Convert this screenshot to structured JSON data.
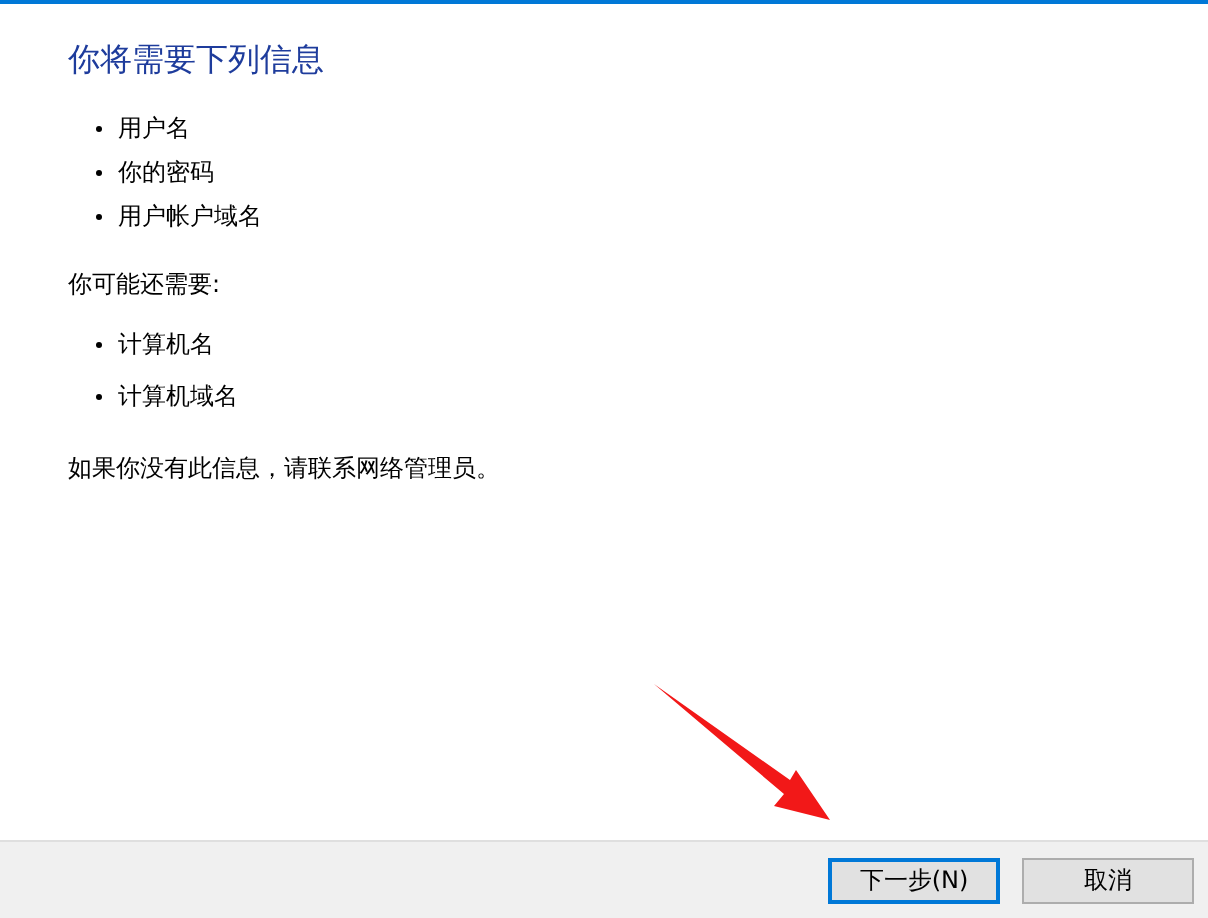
{
  "heading": "你将需要下列信息",
  "required_items": [
    "用户名",
    "你的密码",
    "用户帐户域名"
  ],
  "optional_label": "你可能还需要:",
  "optional_items": [
    "计算机名",
    "计算机域名"
  ],
  "note": "如果你没有此信息，请联系网络管理员。",
  "buttons": [
    {
      "label": "下一步(N)",
      "default": true
    },
    {
      "label": "取消",
      "default": false
    }
  ]
}
